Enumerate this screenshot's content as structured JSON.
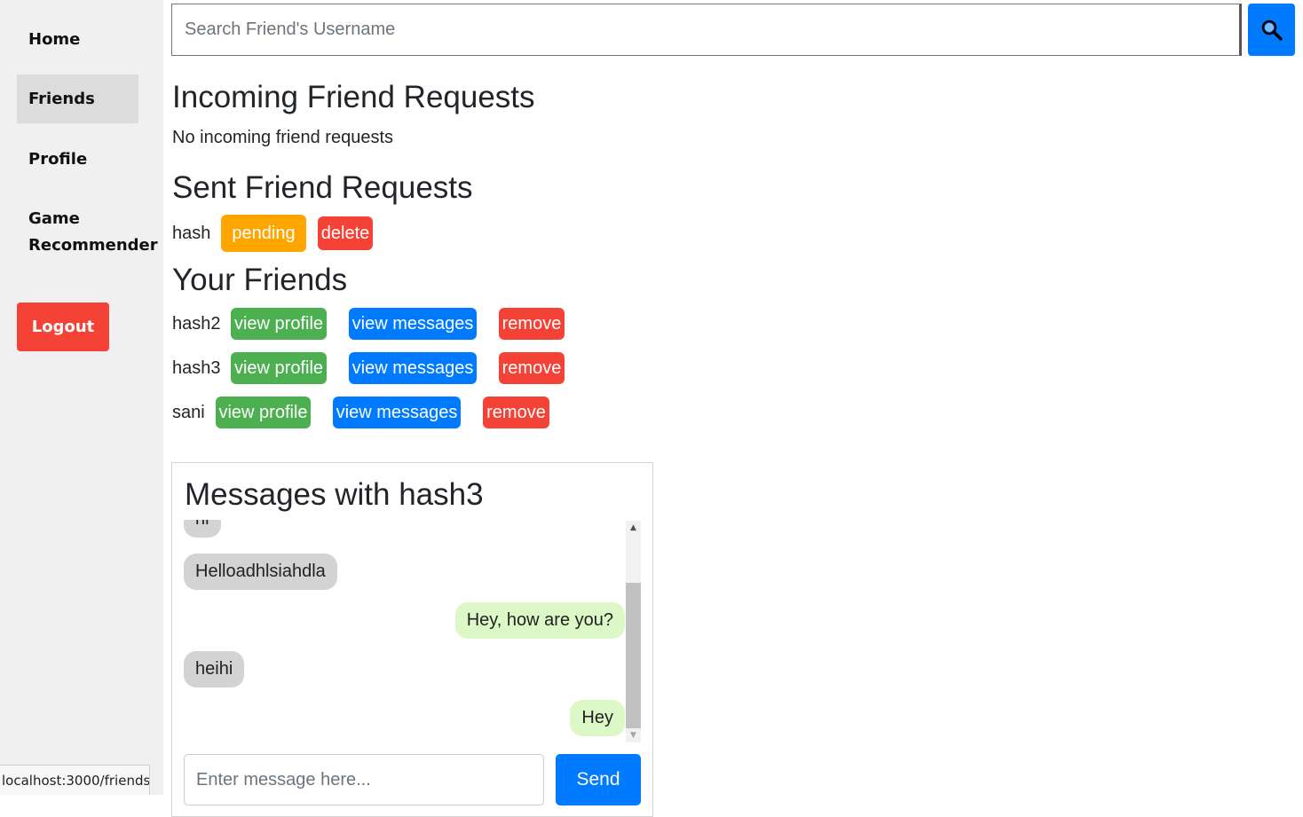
{
  "sidebar": {
    "items": [
      {
        "label": "Home"
      },
      {
        "label": "Friends"
      },
      {
        "label": "Profile"
      },
      {
        "label": "Game Recommender"
      }
    ],
    "logout_label": "Logout"
  },
  "search": {
    "placeholder": "Search Friend's Username",
    "button_icon": "search-icon"
  },
  "incoming": {
    "heading": "Incoming Friend Requests",
    "empty_text": "No incoming friend requests"
  },
  "sent": {
    "heading": "Sent Friend Requests",
    "requests": [
      {
        "username": "hash",
        "status_label": "pending",
        "delete_label": "delete"
      }
    ]
  },
  "friends": {
    "heading": "Your Friends",
    "list": [
      {
        "username": "hash2",
        "view_profile_label": "view profile",
        "view_messages_label": "view messages",
        "remove_label": "remove"
      },
      {
        "username": "hash3",
        "view_profile_label": "view profile",
        "view_messages_label": "view messages",
        "remove_label": "remove"
      },
      {
        "username": "sani",
        "view_profile_label": "view profile",
        "view_messages_label": "view messages",
        "remove_label": "remove"
      }
    ]
  },
  "messages": {
    "title": "Messages with hash3",
    "items": [
      {
        "text": "hi",
        "direction": "incoming"
      },
      {
        "text": "Helloadhlsiahdla",
        "direction": "incoming"
      },
      {
        "text": "Hey, how are you?",
        "direction": "outgoing"
      },
      {
        "text": "heihi",
        "direction": "incoming"
      },
      {
        "text": "Hey",
        "direction": "outgoing"
      }
    ],
    "input_placeholder": "Enter message here...",
    "send_label": "Send"
  },
  "status_bar": {
    "url": "localhost:3000/friends"
  },
  "colors": {
    "primary_blue": "#007bff",
    "danger_red": "#f44336",
    "success_green": "#4caf50",
    "pending_orange": "#ffa500",
    "incoming_bubble": "#d3d3d3",
    "outgoing_bubble": "#dcf8c6"
  }
}
